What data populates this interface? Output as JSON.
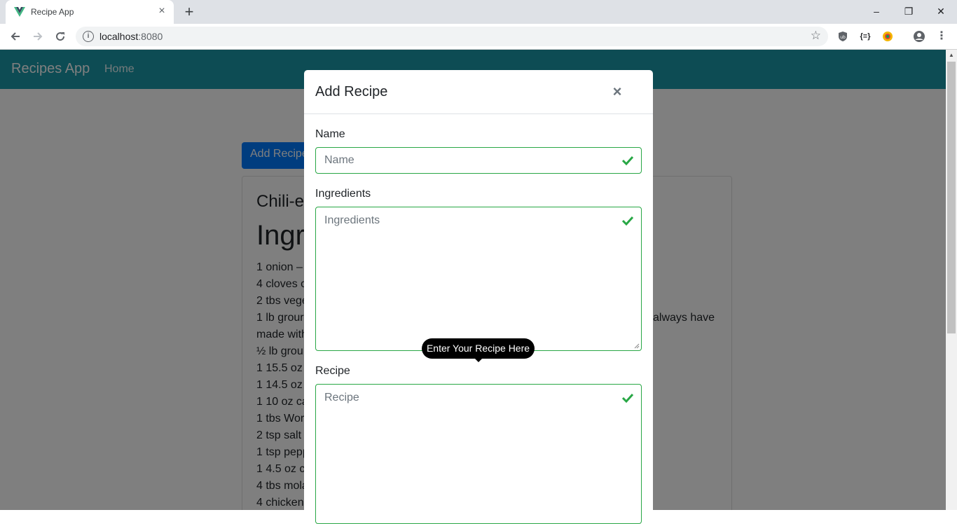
{
  "browser": {
    "tab_title": "Recipe App",
    "tab_close": "×",
    "new_tab": "+",
    "url_host": "localhost",
    "url_port": ":8080",
    "window_controls": {
      "minimize": "–",
      "restore": "❐",
      "close": "✕"
    },
    "extensions": [
      "shield-icon",
      "json-icon",
      "colorful-extension-icon"
    ],
    "ext_json_label": "{≡}"
  },
  "app": {
    "brand": "Recipes App",
    "nav_home": "Home",
    "add_button": "Add Recipe",
    "card": {
      "title": "Chili-e",
      "heading": "Ingr",
      "ingredients": [
        "1 onion –",
        "4 cloves o",
        "2 tbs vege",
        "1 lb grour",
        "made with",
        "½ lb grou",
        "1 15.5 oz",
        "1 14.5 oz",
        "1 10 oz ca",
        "1 tbs Wor",
        "2 tsp salt",
        "1 tsp pepp",
        "1 4.5 oz ca",
        "4 tbs mola",
        "4 chicken"
      ],
      "ingredient_overflow_text": "always have"
    }
  },
  "modal": {
    "title": "Add Recipe",
    "close": "×",
    "fields": {
      "name": {
        "label": "Name",
        "placeholder": "Name"
      },
      "ingredients": {
        "label": "Ingredients",
        "placeholder": "Ingredients"
      },
      "recipe": {
        "label": "Recipe",
        "placeholder": "Recipe"
      }
    },
    "tooltip": "Enter Your Recipe Here"
  },
  "colors": {
    "navbar": "#0f5961",
    "primary": "#007bff",
    "valid": "#28a745"
  }
}
